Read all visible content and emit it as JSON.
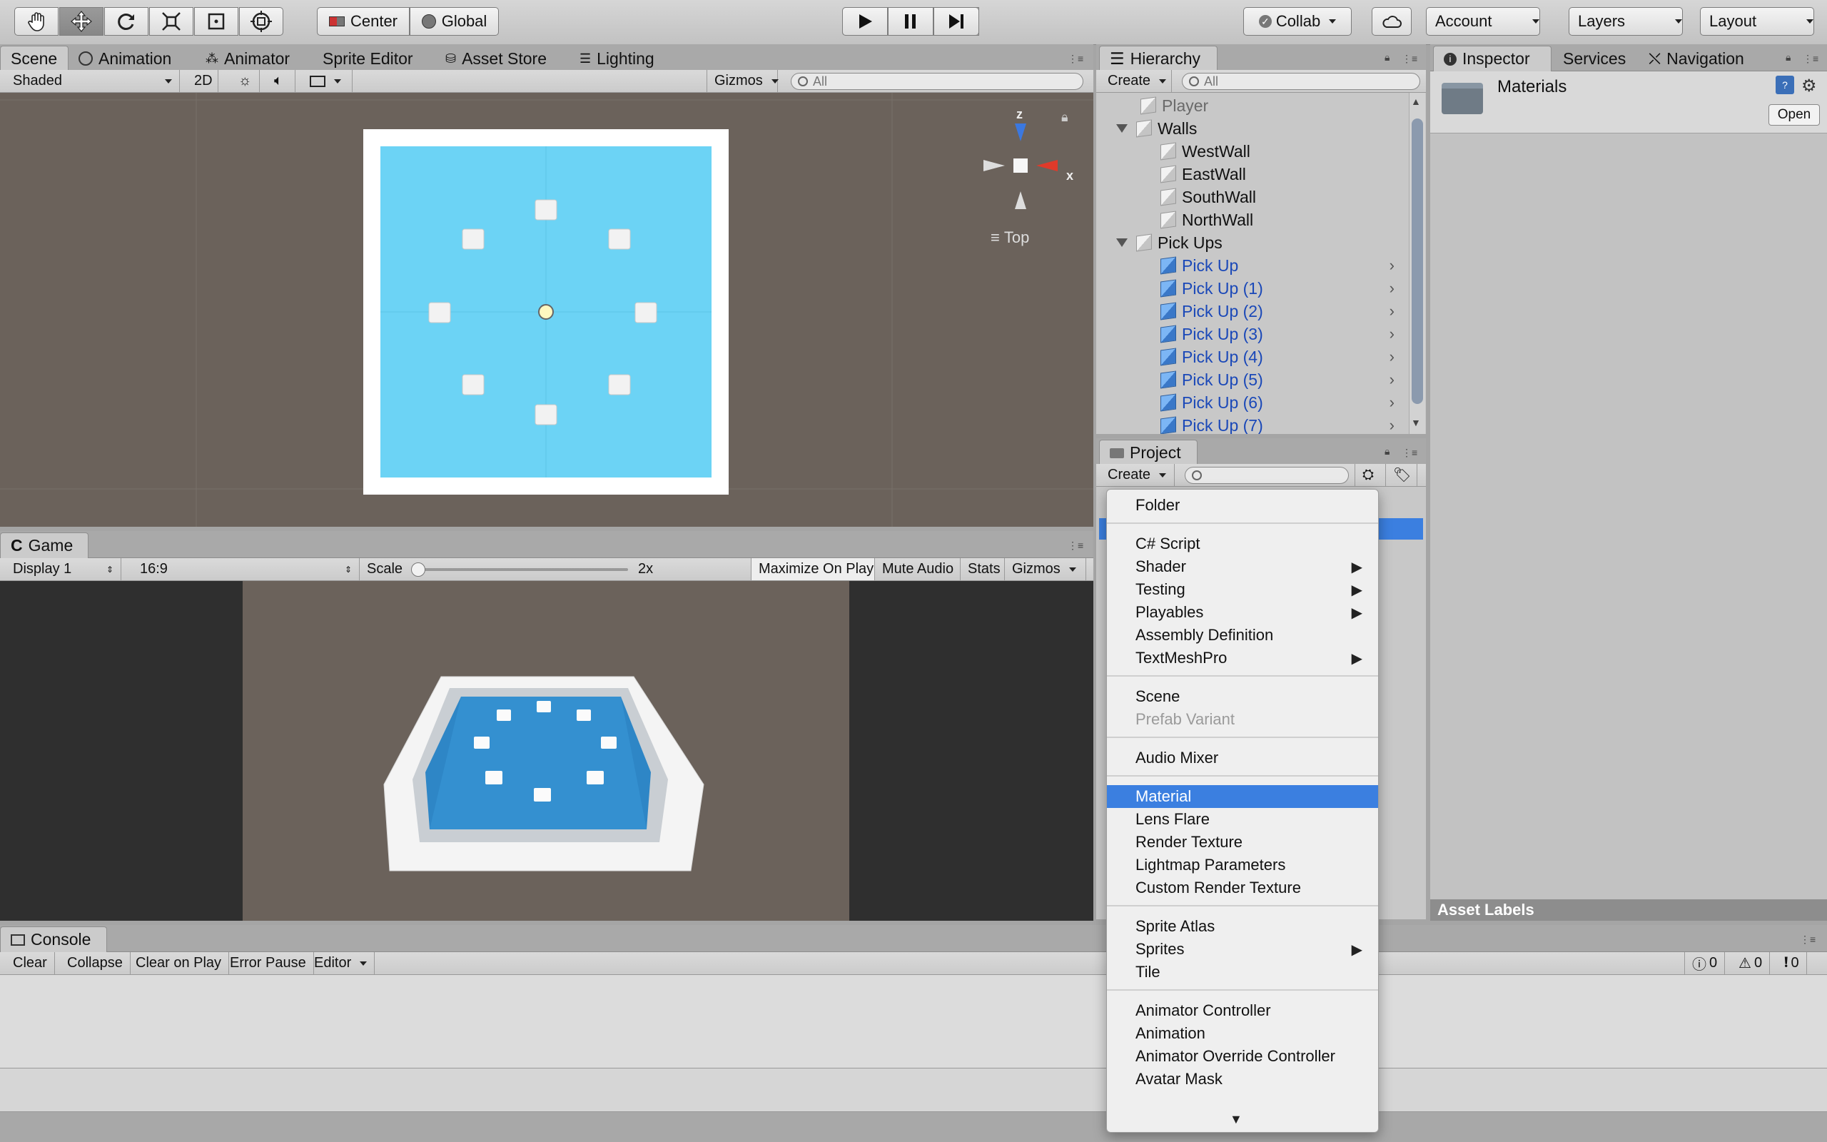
{
  "toolbar": {
    "tools": [
      "hand-tool-icon",
      "move-tool-icon",
      "rotate-tool-icon",
      "scale-tool-icon",
      "rect-tool-icon",
      "transform-tool-icon"
    ],
    "pivot": "Center",
    "space": "Global",
    "collab": "Collab",
    "account": "Account",
    "layers": "Layers",
    "layout": "Layout"
  },
  "scene_tabs": [
    "Scene",
    "Animation",
    "Animator",
    "Sprite Editor",
    "Asset Store",
    "Lighting"
  ],
  "scene_bar": {
    "shading": "Shaded",
    "mode2d": "2D",
    "gizmos": "Gizmos",
    "search_placeholder": "All"
  },
  "gizmo": {
    "z": "z",
    "x": "x",
    "view": "Top"
  },
  "game": {
    "tab": "Game",
    "display": "Display 1",
    "aspect": "16:9",
    "scale_label": "Scale",
    "scale_value": "2x",
    "maximize": "Maximize On Play",
    "mute": "Mute Audio",
    "stats": "Stats",
    "gizmos": "Gizmos"
  },
  "hierarchy": {
    "tab": "Hierarchy",
    "create": "Create",
    "search_placeholder": "All",
    "items": [
      {
        "label": "Player",
        "indent": 0,
        "type": "plain"
      },
      {
        "label": "Walls",
        "indent": 0,
        "type": "expanded"
      },
      {
        "label": "WestWall",
        "indent": 1,
        "type": "plain"
      },
      {
        "label": "EastWall",
        "indent": 1,
        "type": "plain"
      },
      {
        "label": "SouthWall",
        "indent": 1,
        "type": "plain"
      },
      {
        "label": "NorthWall",
        "indent": 1,
        "type": "plain"
      },
      {
        "label": "Pick Ups",
        "indent": 0,
        "type": "expanded"
      },
      {
        "label": "Pick Up",
        "indent": 1,
        "type": "prefab"
      },
      {
        "label": "Pick Up (1)",
        "indent": 1,
        "type": "prefab"
      },
      {
        "label": "Pick Up (2)",
        "indent": 1,
        "type": "prefab"
      },
      {
        "label": "Pick Up (3)",
        "indent": 1,
        "type": "prefab"
      },
      {
        "label": "Pick Up (4)",
        "indent": 1,
        "type": "prefab"
      },
      {
        "label": "Pick Up (5)",
        "indent": 1,
        "type": "prefab"
      },
      {
        "label": "Pick Up (6)",
        "indent": 1,
        "type": "prefab"
      },
      {
        "label": "Pick Up (7)",
        "indent": 1,
        "type": "prefab"
      }
    ]
  },
  "project": {
    "tab": "Project",
    "create": "Create"
  },
  "inspector": {
    "tabs": [
      "Inspector",
      "Services",
      "Navigation"
    ],
    "title": "Materials",
    "open": "Open",
    "asset_labels": "Asset Labels"
  },
  "console": {
    "tab": "Console",
    "buttons": [
      "Clear",
      "Collapse",
      "Clear on Play",
      "Error Pause",
      "Editor"
    ],
    "info_count": "0",
    "warn_count": "0",
    "error_count": "0"
  },
  "create_menu": {
    "items": [
      {
        "label": "Folder"
      },
      {
        "sep": true
      },
      {
        "label": "C# Script"
      },
      {
        "label": "Shader",
        "sub": true
      },
      {
        "label": "Testing",
        "sub": true
      },
      {
        "label": "Playables",
        "sub": true
      },
      {
        "label": "Assembly Definition"
      },
      {
        "label": "TextMeshPro",
        "sub": true
      },
      {
        "sep": true
      },
      {
        "label": "Scene"
      },
      {
        "label": "Prefab Variant",
        "disabled": true
      },
      {
        "sep": true
      },
      {
        "label": "Audio Mixer"
      },
      {
        "sep": true
      },
      {
        "label": "Material",
        "highlight": true
      },
      {
        "label": "Lens Flare"
      },
      {
        "label": "Render Texture"
      },
      {
        "label": "Lightmap Parameters"
      },
      {
        "label": "Custom Render Texture"
      },
      {
        "sep": true
      },
      {
        "label": "Sprite Atlas"
      },
      {
        "label": "Sprites",
        "sub": true
      },
      {
        "label": "Tile"
      },
      {
        "sep": true
      },
      {
        "label": "Animator Controller"
      },
      {
        "label": "Animation"
      },
      {
        "label": "Animator Override Controller"
      },
      {
        "label": "Avatar Mask"
      }
    ]
  },
  "colors": {
    "accent": "#3b7fe0",
    "floor": "#6cd3f5",
    "scene_bg": "#6b625b",
    "prefab_text": "#1a48b8"
  }
}
